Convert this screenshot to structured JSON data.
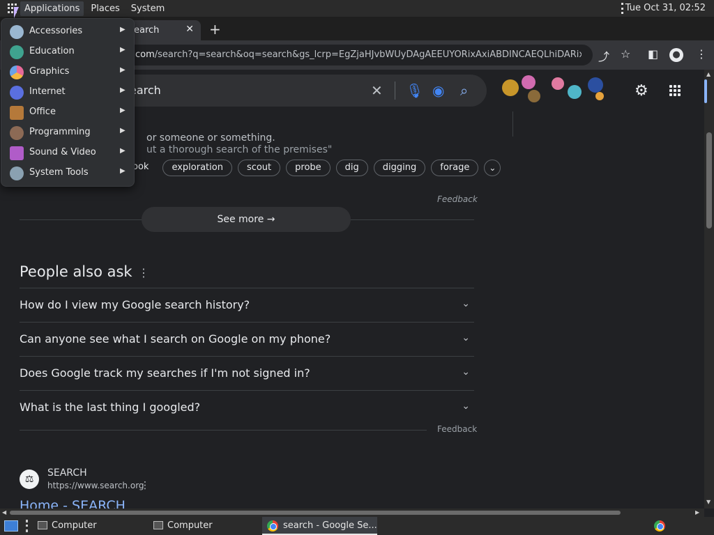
{
  "panel": {
    "menus": [
      "Applications",
      "Places",
      "System"
    ],
    "clock": "Tue Oct 31, 02:52"
  },
  "browser": {
    "tab_title": "earch",
    "url_host": "com",
    "url_rest": "/search?q=search&oq=search&gs_lcrp=EgZjaHJvbWUyDAgAEEUYORixAxiABDINCAEQLhiDARixAxi...",
    "window_buttons": [
      "#f8e0a0",
      "#8fd68f",
      "#f08aa6"
    ]
  },
  "search": {
    "query": "earch",
    "definition_1": "or someone or something.",
    "definition_2": "ut a thorough search of the premises\"",
    "chips": [
      "ook",
      "exploration",
      "scout",
      "probe",
      "dig",
      "digging",
      "forage"
    ],
    "feedback": "Feedback",
    "see_more": "See more"
  },
  "paa": {
    "title": "People also ask",
    "questions": [
      "How do I view my Google search history?",
      "Can anyone see what I search on Google on my phone?",
      "Does Google track my searches if I'm not signed in?",
      "What is the last thing I googled?"
    ],
    "feedback": "Feedback"
  },
  "result": {
    "site": "SEARCH",
    "url": "https://www.search.org",
    "title": "Home - SEARCH"
  },
  "app_menu": {
    "items": [
      {
        "label": "Accessories",
        "icon": "accessories-icon",
        "color": "#9ab7d1"
      },
      {
        "label": "Education",
        "icon": "education-icon",
        "color": "#3fa38f"
      },
      {
        "label": "Graphics",
        "icon": "graphics-icon",
        "color": "#e86a9a"
      },
      {
        "label": "Internet",
        "icon": "internet-icon",
        "color": "#5a6fe0"
      },
      {
        "label": "Office",
        "icon": "office-icon",
        "color": "#b5793a"
      },
      {
        "label": "Programming",
        "icon": "programming-icon",
        "color": "#8c6a55"
      },
      {
        "label": "Sound & Video",
        "icon": "sound-video-icon",
        "color": "#b05cc8"
      },
      {
        "label": "System Tools",
        "icon": "system-tools-icon",
        "color": "#8aa1b1"
      }
    ]
  },
  "taskbar": {
    "tasks": [
      "Computer",
      "Computer",
      "search - Google Se..."
    ]
  }
}
